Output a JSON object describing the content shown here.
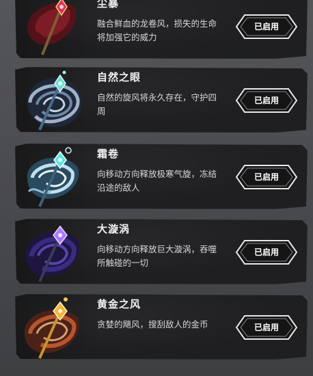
{
  "skills": [
    {
      "name": "尘暴",
      "description": "融合鲜血的龙卷风，损失的生命将加强它的威力",
      "button_label": "已启用",
      "gem_color": "#e0325a",
      "swirl_color": "#7a1c22"
    },
    {
      "name": "自然之眼",
      "description": "自然的旋风将永久存在，守护四周",
      "button_label": "已启用",
      "gem_color": "#6be0c8",
      "swirl_color": "#8a9fb8"
    },
    {
      "name": "霜卷",
      "description": "向移动方向释放极寒气旋，冻结沿途的敌人",
      "button_label": "已启用",
      "gem_color": "#58e6e0",
      "swirl_color": "#9ec6d8"
    },
    {
      "name": "大漩涡",
      "description": "向移动方向释放巨大漩涡，吞噬所触碰的一切",
      "button_label": "已启用",
      "gem_color": "#a97aff",
      "swirl_color": "#3a2a7a"
    },
    {
      "name": "黄金之风",
      "description": "贪婪的飓风，搜刮敌人的金币",
      "button_label": "已启用",
      "gem_color": "#f3b640",
      "swirl_color": "#b7562e"
    }
  ]
}
